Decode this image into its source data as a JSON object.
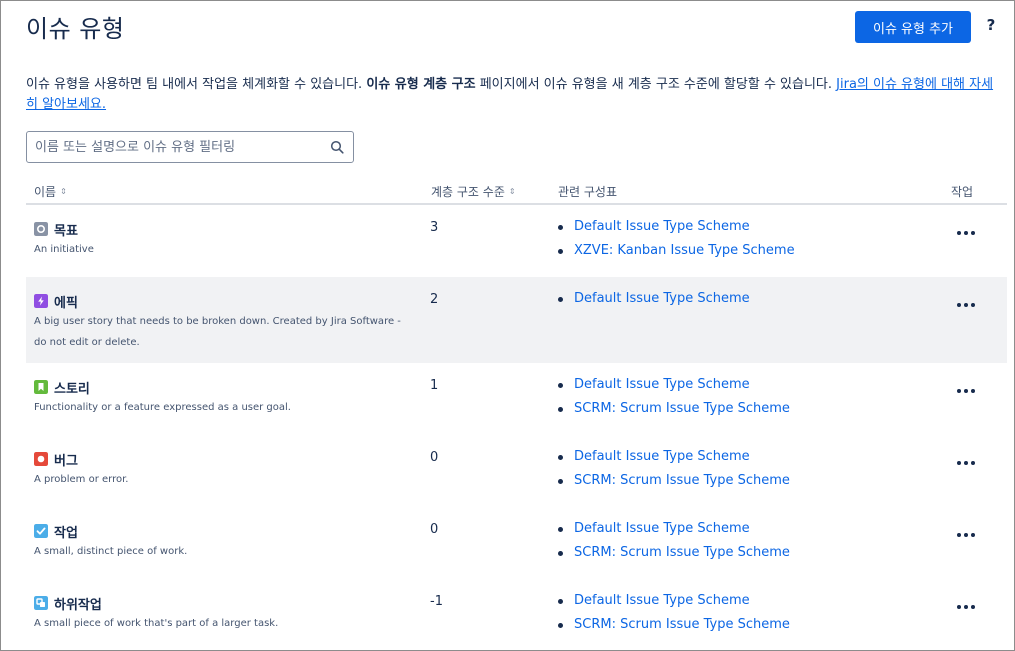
{
  "header": {
    "title": "이슈 유형",
    "add_button": "이슈 유형 추가",
    "help": "?"
  },
  "description": {
    "part1": "이슈 유형을 사용하면 팀 내에서 작업을 체계화할 수 있습니다. ",
    "bold": "이슈 유형 계층 구조",
    "part2": " 페이지에서 이슈 유형을 새 계층 구조 수준에 할당할 수 있습니다. ",
    "link": "Jira의 이슈 유형에 대해 자세히 알아보세요."
  },
  "search": {
    "placeholder": "이름 또는 설명으로 이슈 유형 필터링",
    "icon": "search-icon"
  },
  "table": {
    "columns": {
      "name": "이름",
      "level": "계층 구조 수준",
      "schemes": "관련 구성표",
      "actions": "작업"
    },
    "rows": [
      {
        "name": "목표",
        "description": "An initiative",
        "level": "3",
        "icon": "goal-icon",
        "icon_color": "#8993a5",
        "schemes": [
          "Default Issue Type Scheme",
          "XZVE: Kanban Issue Type Scheme"
        ]
      },
      {
        "name": "에픽",
        "description": "A big user story that needs to be broken down. Created by Jira Software - do not edit or delete.",
        "level": "2",
        "icon": "epic-icon",
        "icon_color": "#904ee2",
        "schemes": [
          "Default Issue Type Scheme"
        ]
      },
      {
        "name": "스토리",
        "description": "Functionality or a feature expressed as a user goal.",
        "level": "1",
        "icon": "story-icon",
        "icon_color": "#63ba3c",
        "schemes": [
          "Default Issue Type Scheme",
          "SCRM: Scrum Issue Type Scheme"
        ]
      },
      {
        "name": "버그",
        "description": "A problem or error.",
        "level": "0",
        "icon": "bug-icon",
        "icon_color": "#e5493a",
        "schemes": [
          "Default Issue Type Scheme",
          "SCRM: Scrum Issue Type Scheme"
        ]
      },
      {
        "name": "작업",
        "description": "A small, distinct piece of work.",
        "level": "0",
        "icon": "task-icon",
        "icon_color": "#4bade8",
        "schemes": [
          "Default Issue Type Scheme",
          "SCRM: Scrum Issue Type Scheme"
        ]
      },
      {
        "name": "하위작업",
        "description": "A small piece of work that's part of a larger task.",
        "level": "-1",
        "icon": "subtask-icon",
        "icon_color": "#4bade8",
        "schemes": [
          "Default Issue Type Scheme",
          "SCRM: Scrum Issue Type Scheme"
        ]
      }
    ]
  },
  "colors": {
    "accent": "#0c66e4",
    "text": "#172b4d",
    "row_highlight": "#f1f2f4"
  }
}
